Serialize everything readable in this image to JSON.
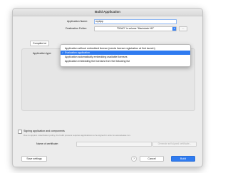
{
  "window": {
    "title": "Build Application"
  },
  "form": {
    "application_name_label": "Application Name:",
    "application_name_value": "myApp",
    "destination_label": "Destination Folder:",
    "destination_value": "\"DDAO\" in volume \"Macintosh HD\"",
    "destination_more": "..."
  },
  "tabs": {
    "compiled_label": "Compiled st"
  },
  "application_type": {
    "label": "Application type:",
    "options": [
      {
        "label": "Application without embedded license (needs license registration at first launch)",
        "selected": false
      },
      {
        "label": "Evaluation application",
        "selected": true
      },
      {
        "label": "Application automatically embedding available licenses",
        "selected": false
      },
      {
        "label": "Application embedding the licenses from the following list",
        "selected": false
      }
    ],
    "check_glyph": "✓"
  },
  "signing": {
    "checkbox_label": "Signing application and components",
    "note": "Due to Apple's notarization policy, the build process requires applications to be signed in order to autorelease run.",
    "certificate_label": "Name of certificate:",
    "generate_button": "Generate self-signed certificate..."
  },
  "footer": {
    "save_settings": "Save settings",
    "help": "?",
    "cancel": "Cancel",
    "build": "Build"
  },
  "colors": {
    "accent": "#2f7bf0",
    "window_bg": "#ececec"
  }
}
